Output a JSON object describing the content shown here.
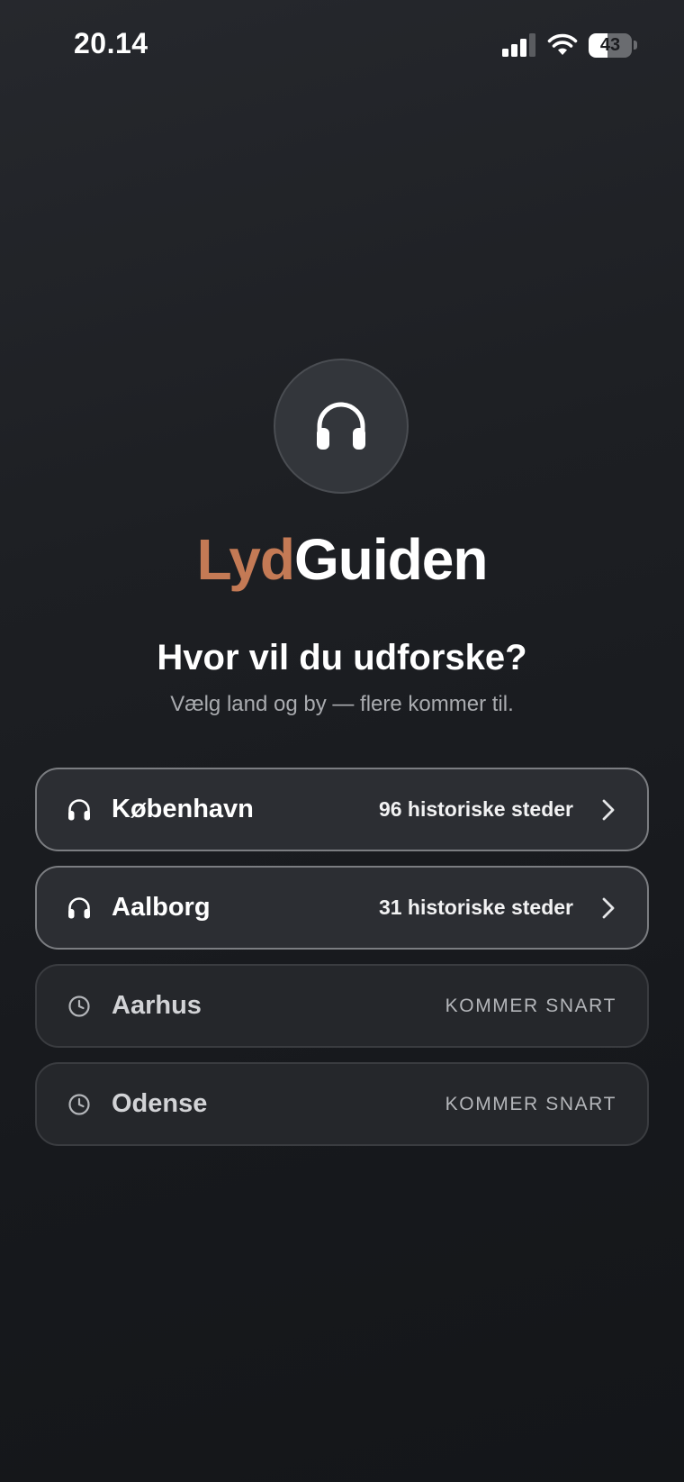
{
  "status_bar": {
    "time": "20.14",
    "battery_percent": "43",
    "battery_level": 0.43
  },
  "app": {
    "logo_icon": "headphones-icon",
    "brand_accent": "Lyd",
    "brand_main": "Guiden",
    "accent_color": "#c47a55"
  },
  "intro": {
    "heading": "Hvor vil du udforske?",
    "subheading": "Vælg land og by — flere kommer til."
  },
  "cities": [
    {
      "name": "København",
      "meta": "96 historiske steder",
      "status": "available",
      "icon": "headphones-icon"
    },
    {
      "name": "Aalborg",
      "meta": "31 historiske steder",
      "status": "available",
      "icon": "headphones-icon"
    },
    {
      "name": "Aarhus",
      "meta": "KOMMER SNART",
      "status": "coming-soon",
      "icon": "clock-icon"
    },
    {
      "name": "Odense",
      "meta": "KOMMER SNART",
      "status": "coming-soon",
      "icon": "clock-icon"
    }
  ]
}
